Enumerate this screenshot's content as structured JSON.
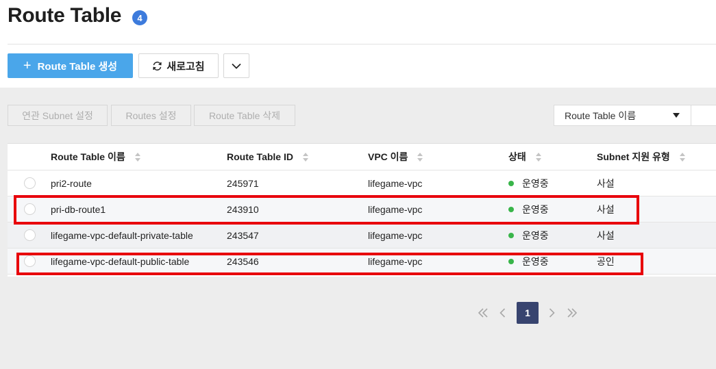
{
  "header": {
    "title": "Route Table",
    "count": "4"
  },
  "toolbar": {
    "create_icon": "plus-icon",
    "create_label": "Route Table 생성",
    "refresh_icon": "refresh-icon",
    "refresh_label": "새로고침",
    "more_icon": "chevron-down-icon"
  },
  "actions": {
    "associate_subnet": "연관 Subnet 설정",
    "routes_settings": "Routes 설정",
    "delete_route_table": "Route Table 삭제"
  },
  "search": {
    "selected_field": "Route Table 이름"
  },
  "table": {
    "columns": [
      "Route Table 이름",
      "Route Table ID",
      "VPC 이름",
      "상태",
      "Subnet 지원 유형"
    ],
    "rows": [
      {
        "name": "pri2-route",
        "id": "245971",
        "vpc": "lifegame-vpc",
        "status": "운영중",
        "type": "사설"
      },
      {
        "name": "pri-db-route1",
        "id": "243910",
        "vpc": "lifegame-vpc",
        "status": "운영중",
        "type": "사설"
      },
      {
        "name": "lifegame-vpc-default-private-table",
        "id": "243547",
        "vpc": "lifegame-vpc",
        "status": "운영중",
        "type": "사설"
      },
      {
        "name": "lifegame-vpc-default-public-table",
        "id": "243546",
        "vpc": "lifegame-vpc",
        "status": "운영중",
        "type": "공인"
      }
    ]
  },
  "pagination": {
    "current_page": "1"
  },
  "colors": {
    "primary": "#4aa6ea",
    "badge": "#3d7bdc",
    "status_running": "#39b54a",
    "highlight": "#e8000b",
    "page_active": "#38446f"
  }
}
